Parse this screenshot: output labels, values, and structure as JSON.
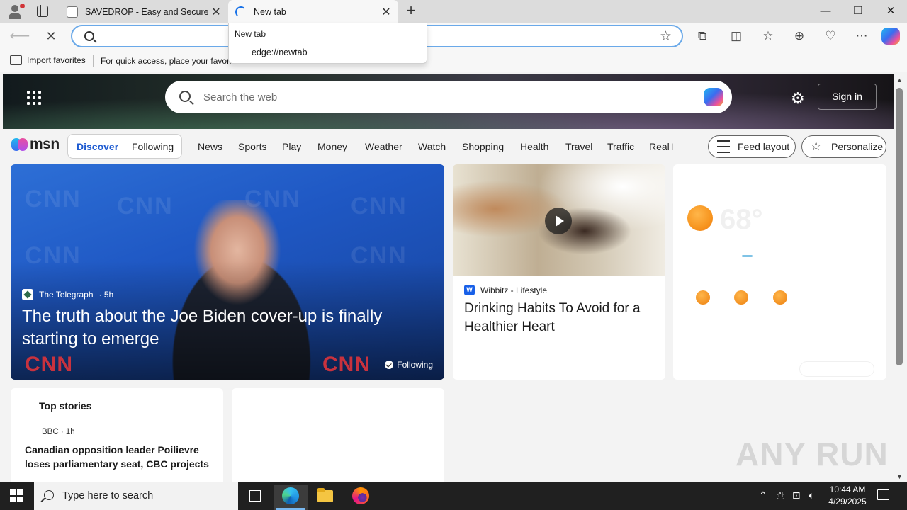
{
  "browser": {
    "tabs": [
      {
        "title": "SAVEDROP - Easy and Secure File",
        "close": "✕"
      },
      {
        "title": "New tab",
        "close": "✕"
      }
    ],
    "new_tab_glyph": "+",
    "window_controls": {
      "minimize": "—",
      "restore": "❐",
      "close": "✕"
    },
    "address_value": "",
    "toolbar_icons": [
      "extensions-icon",
      "split-screen-icon",
      "favorites-icon",
      "collections-icon",
      "browser-essentials-icon",
      "more-icon",
      "copilot-icon"
    ],
    "favorites_bar": {
      "import_label": "Import favorites",
      "hint": "For quick access, place your favori"
    },
    "dropdown": {
      "title": "New tab",
      "url": "edge://newtab"
    }
  },
  "msn": {
    "search_placeholder": "Search the web",
    "sign_in": "Sign in",
    "logo_text": "msn",
    "pill": {
      "discover": "Discover",
      "following": "Following"
    },
    "categories": [
      "News",
      "Sports",
      "Play",
      "Money",
      "Weather",
      "Watch",
      "Shopping",
      "Health",
      "Travel",
      "Traffic",
      "Real E"
    ],
    "feed_layout": "Feed layout",
    "personalize": "Personalize",
    "main_card": {
      "source": "The Telegraph",
      "age": "· 5h",
      "headline": "The truth about the Joe Biden cover-up is finally starting to emerge",
      "badge": "Following",
      "bg_text": "CNN"
    },
    "mid_card": {
      "source": "Wibbitz - Lifestyle",
      "source_icon": "W",
      "headline": "Drinking Habits To Avoid for a Healthier Heart"
    },
    "weather_card": {
      "temp": "68°"
    },
    "top_stories": {
      "title": "Top stories",
      "source": "BBC · 1h",
      "headline": "Canadian opposition leader Poilievre loses parliamentary seat, CBC projects"
    },
    "colors": {
      "accent": "#1e5bd1",
      "hero_card": "#1f58c4"
    }
  },
  "watermark": "ANY RUN",
  "taskbar": {
    "search_text": "Type here to search",
    "time": "10:44 AM",
    "date": "4/29/2025"
  }
}
